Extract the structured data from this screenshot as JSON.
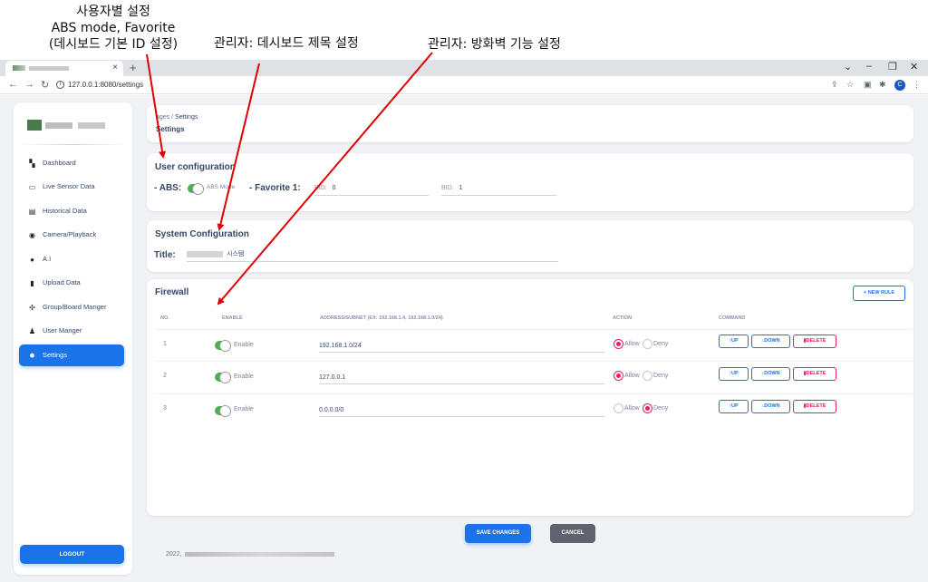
{
  "annotations": {
    "user_settings": "사용자별 설정",
    "user_settings_2": "ABS mode,  Favorite",
    "user_settings_3": "(데시보드 기본 ID 설정)",
    "admin_title": "관리자: 데시보드 제목 설정",
    "admin_firewall": "관리자: 방화벽 기능 설정"
  },
  "browser": {
    "tab_close": "×",
    "new_tab": "+",
    "url": "127.0.0.1:8080/settings",
    "profile_initial": "C"
  },
  "sidebar": {
    "items": [
      {
        "label": "Dashboard",
        "icon": "dashboard-icon"
      },
      {
        "label": "Live Sensor Data",
        "icon": "cast-icon"
      },
      {
        "label": "Historical Data",
        "icon": "library-icon"
      },
      {
        "label": "Camera/Playback",
        "icon": "play-circle-icon"
      },
      {
        "label": "A.I",
        "icon": "bulb-icon"
      },
      {
        "label": "Upload Data",
        "icon": "file-icon"
      },
      {
        "label": "Group/Board Manger",
        "icon": "hub-icon"
      },
      {
        "label": "User Manger",
        "icon": "person-icon"
      },
      {
        "label": "Settings",
        "icon": "gear-icon"
      }
    ],
    "active": "Settings",
    "logout": "LOGOUT"
  },
  "header": {
    "breadcrumb_parent": "ages",
    "breadcrumb_sep": "/",
    "breadcrumb_current": "Settings",
    "title": "Settings"
  },
  "user_config": {
    "title": "User configuration",
    "abs_label": "- ABS:",
    "abs_toggle_label": "ABS Mode",
    "abs_on": true,
    "favorite_label": "- Favorite 1:",
    "bid1_placeholder": "BID:",
    "bid1_value": "0",
    "bid2_placeholder": "BID:",
    "bid2_value": "1"
  },
  "system_config": {
    "title": "System Configuration",
    "title_label": "Title:",
    "title_value": "시스템"
  },
  "firewall": {
    "title": "Firewall",
    "new_rule": "+ NEW RULE",
    "columns": [
      "NO.",
      "ENABLE",
      "ADDRESS/SUBNET (EX: 192.168.1.4, 192.168.1.0/24)",
      "ACTION",
      "COMMAND"
    ],
    "rules": [
      {
        "no": "1",
        "enable_label": "Enable",
        "enabled": true,
        "address": "192.168.1.0/24",
        "action": "Allow"
      },
      {
        "no": "2",
        "enable_label": "Enable",
        "enabled": true,
        "address": "127.0.0.1",
        "action": "Allow"
      },
      {
        "no": "3",
        "enable_label": "Enable",
        "enabled": true,
        "address": "0.0.0.0/0",
        "action": "Deny"
      }
    ],
    "allow_label": "Allow",
    "deny_label": "Deny",
    "up_label": "↑UP",
    "down_label": "↓DOWN",
    "delete_label": "DELETE"
  },
  "actions": {
    "save": "SAVE CHANGES",
    "cancel": "CANCEL"
  },
  "footer": {
    "year": "2022,"
  },
  "colors": {
    "primary": "#1a73e8",
    "danger": "#e91e63",
    "toggle_on": "#4caf50",
    "annotation_arrow": "#e00000"
  }
}
